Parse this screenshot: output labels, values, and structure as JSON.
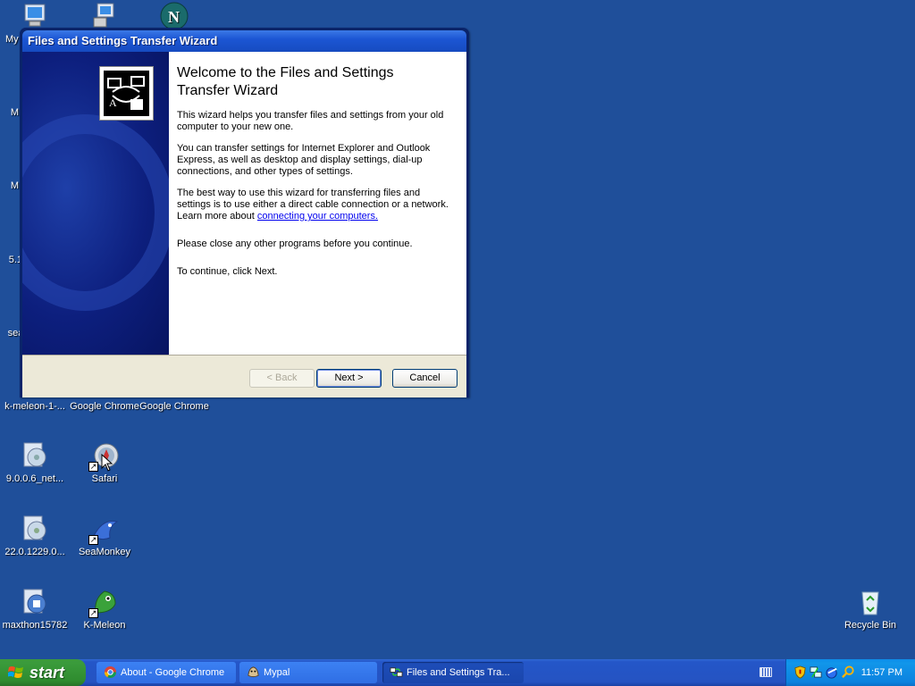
{
  "desktop": {
    "icons": [
      {
        "id": "my-computer",
        "label": "My"
      },
      {
        "id": "icon-m1",
        "label": "M"
      },
      {
        "id": "icon-m2",
        "label": "M"
      },
      {
        "id": "icon-51",
        "label": "5.1"
      },
      {
        "id": "icon-sea",
        "label": "sear"
      },
      {
        "id": "kmeleon-installer",
        "label": "k-meleon-1-..."
      },
      {
        "id": "google-chrome-1",
        "label": "Google Chrome"
      },
      {
        "id": "google-chrome-2",
        "label": "Google Chrome"
      },
      {
        "id": "net-installer",
        "label": "9.0.0.6_net..."
      },
      {
        "id": "safari",
        "label": "Safari"
      },
      {
        "id": "installer-22",
        "label": "22.0.1229.0..."
      },
      {
        "id": "seamonkey",
        "label": "SeaMonkey"
      },
      {
        "id": "maxthon",
        "label": "maxthon15782"
      },
      {
        "id": "kmeleon",
        "label": "K-Meleon"
      },
      {
        "id": "recycle-bin",
        "label": "Recycle Bin"
      }
    ]
  },
  "wizard": {
    "title": "Files and Settings Transfer Wizard",
    "heading": "Welcome to the Files and Settings Transfer Wizard",
    "para1": "This wizard helps you transfer files and settings from your old computer to your new one.",
    "para2": "You can transfer settings for Internet Explorer and Outlook Express, as well as desktop and display settings, dial-up connections, and other types of settings.",
    "para3_before": "The best way to use this wizard for transferring files and settings is to use either a direct cable connection or a network. Learn more about ",
    "para3_link": "connecting your computers.",
    "para4": "Please close any other programs before you continue.",
    "para5": "To continue, click Next.",
    "buttons": {
      "back": "< Back",
      "next": "Next >",
      "cancel": "Cancel"
    }
  },
  "taskbar": {
    "start_label": "start",
    "tasks": [
      {
        "label": "About - Google Chrome",
        "icon": "chrome-icon"
      },
      {
        "label": "Mypal",
        "icon": "mypal-icon"
      },
      {
        "label": "Files and Settings Tra...",
        "icon": "transfer-wizard-icon",
        "active": true
      }
    ],
    "clock": "11:57 PM"
  }
}
